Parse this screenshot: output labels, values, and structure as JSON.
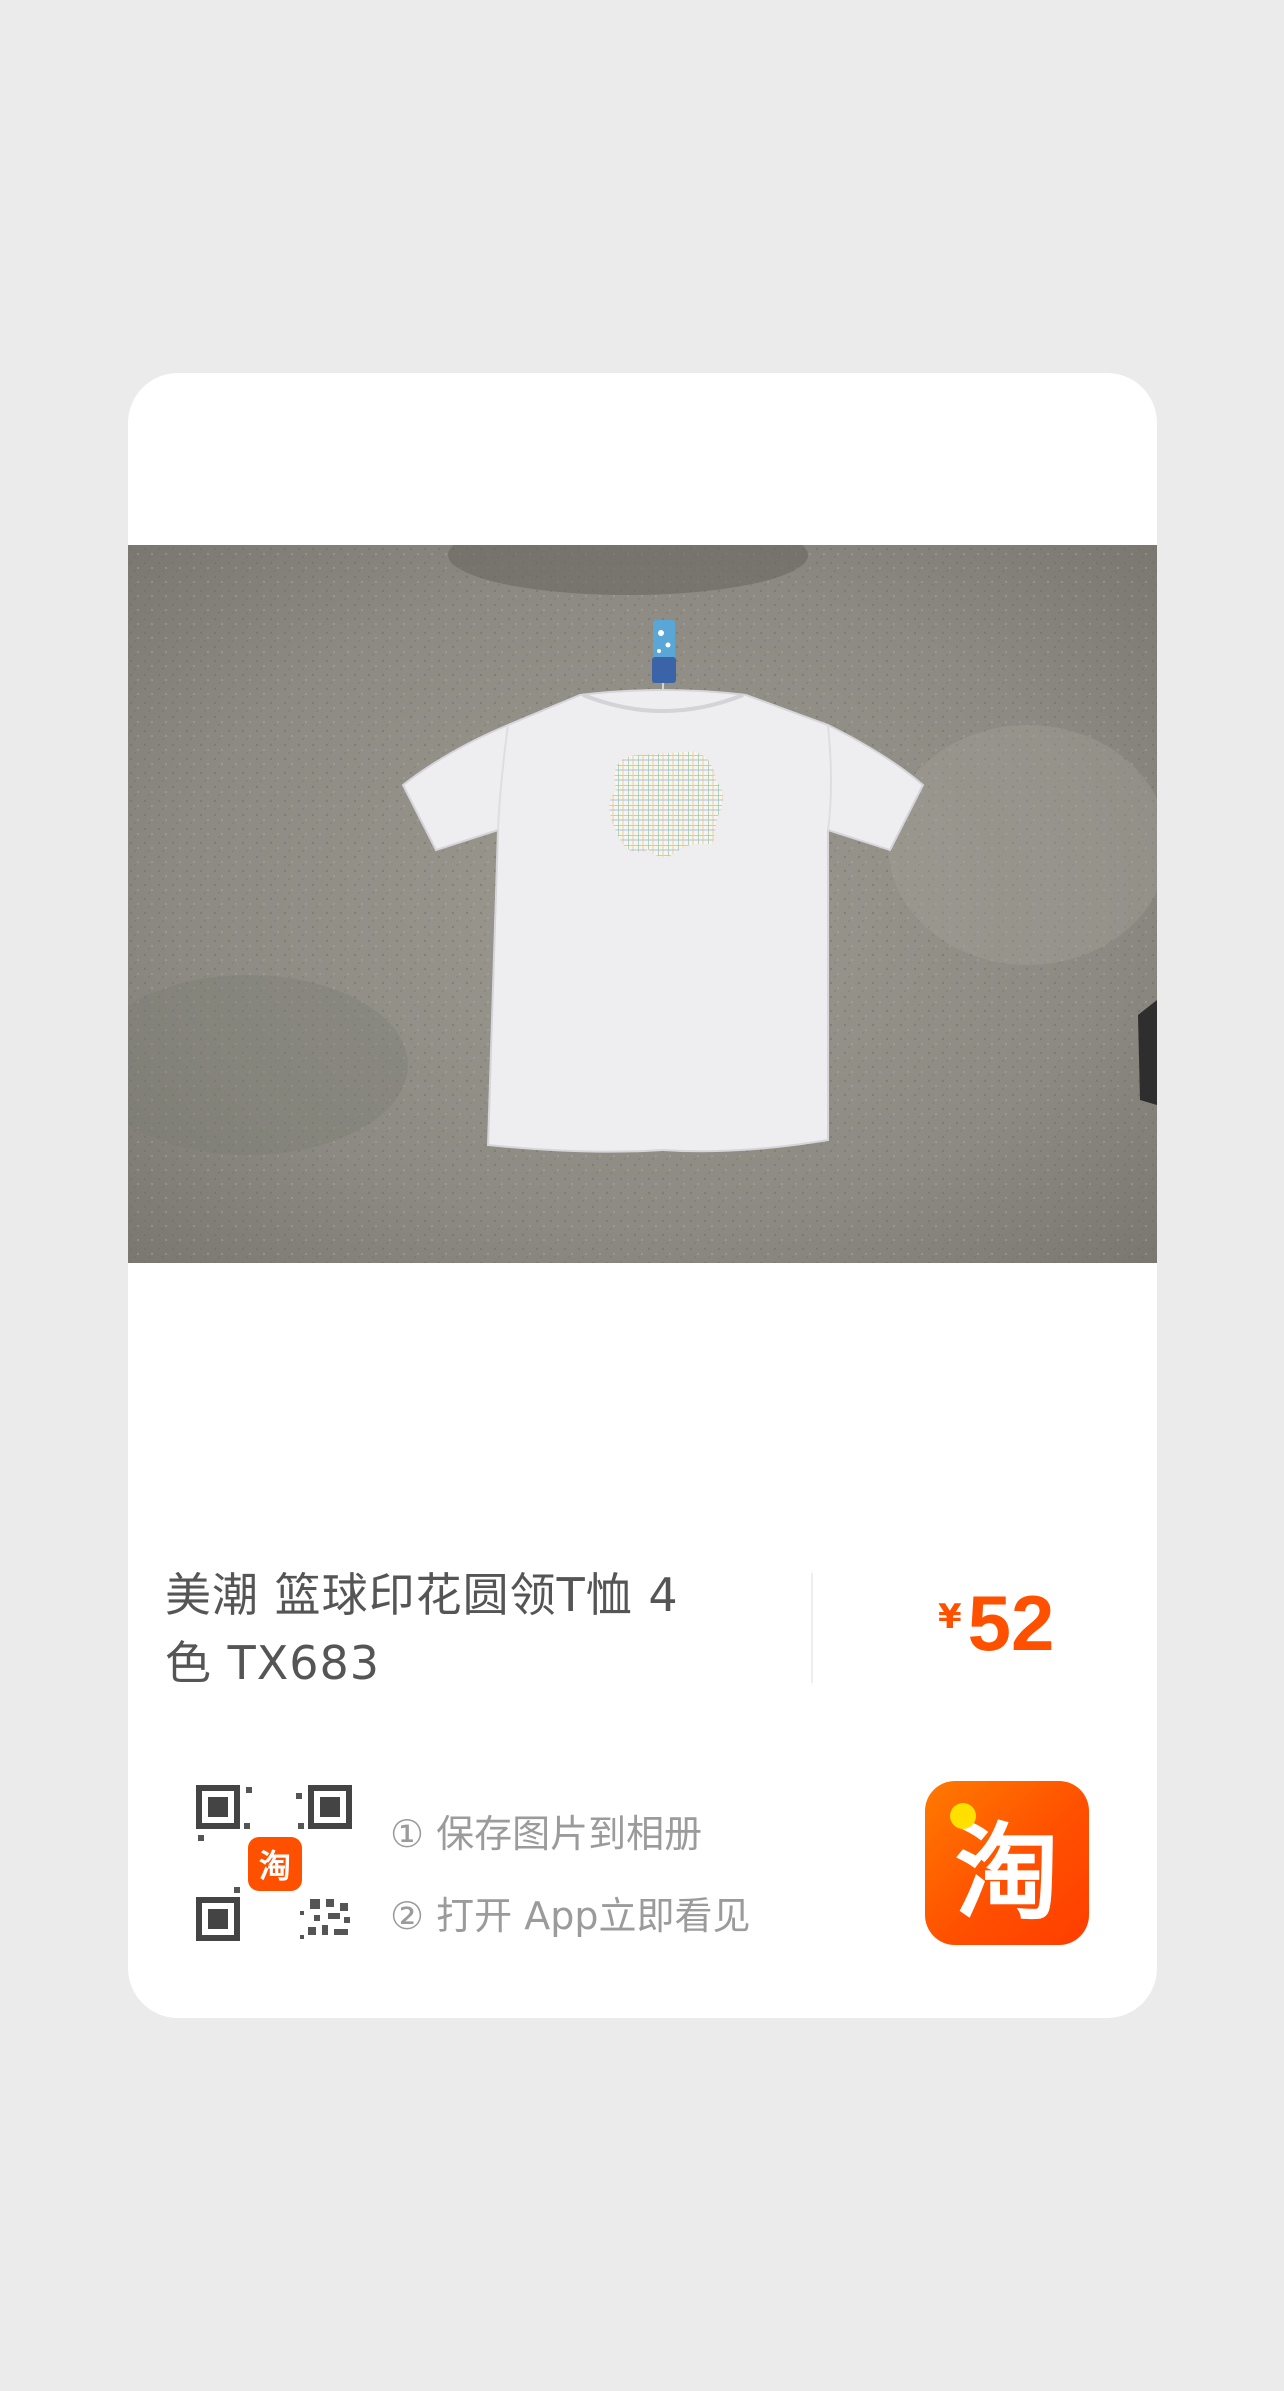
{
  "product": {
    "title_line1": "美潮 篮球印花圆领T恤 4",
    "title_line2": "色 TX683",
    "currency": "¥",
    "price": "52"
  },
  "share": {
    "step1": "① 保存图片到相册",
    "step2": "② 打开 App立即看见",
    "qr_logo_text": "淘",
    "app_icon_text": "淘"
  },
  "colors": {
    "accent": "#ff5000",
    "background": "#ebebeb",
    "card": "#ffffff"
  },
  "icons": {
    "qr": "qr-code-icon",
    "app": "taobao-app-icon"
  }
}
